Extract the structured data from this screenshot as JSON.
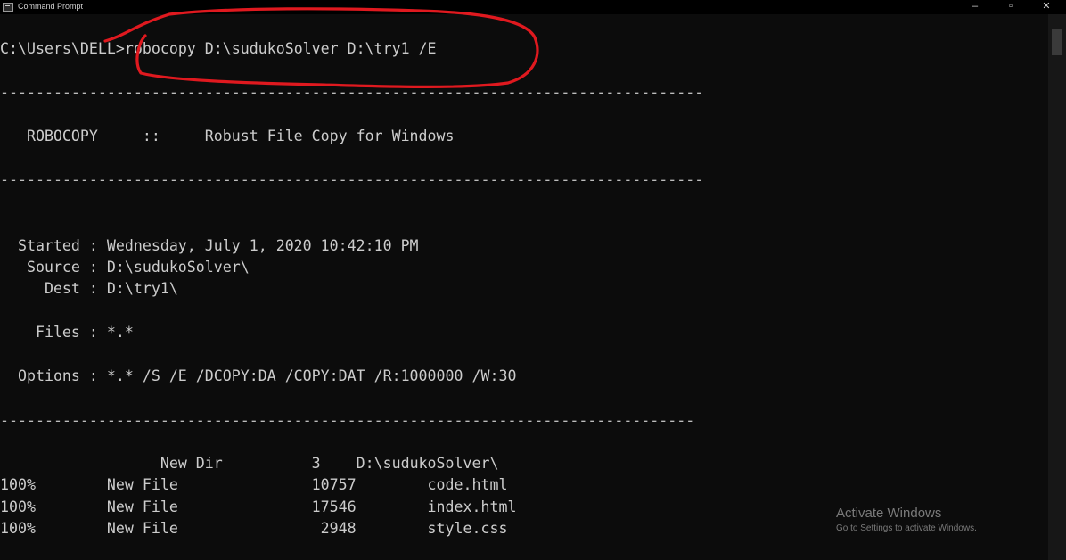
{
  "window": {
    "title": "Command Prompt",
    "controls": {
      "minimize": "–",
      "maximize": "▫",
      "close": "✕"
    }
  },
  "console": {
    "command_prompt": "C:\\Users\\DELL>",
    "command": "robocopy D:\\sudukoSolver D:\\try1 /E",
    "separator": "-------------------------------------------------------------------------------",
    "separator_short": "------------------------------------------------------------------------------",
    "banner": "   ROBOCOPY     ::     Robust File Copy for Windows",
    "started": "  Started : Wednesday, July 1, 2020 10:42:10 PM",
    "source": "   Source : D:\\sudukoSolver\\",
    "dest": "     Dest : D:\\try1\\",
    "files": "    Files : *.*",
    "options": "  Options : *.* /S /E /DCOPY:DA /COPY:DAT /R:1000000 /W:30",
    "rows": [
      "\t          New Dir          3    D:\\sudukoSolver\\",
      "100%        New File               10757        code.html",
      "100%        New File               17546        index.html",
      "100%        New File                2948        style.css"
    ]
  },
  "watermark": {
    "title": "Activate Windows",
    "subtitle": "Go to Settings to activate Windows."
  },
  "colors": {
    "background": "#0c0c0c",
    "text": "#cccccc",
    "annotation": "#e0191f"
  }
}
